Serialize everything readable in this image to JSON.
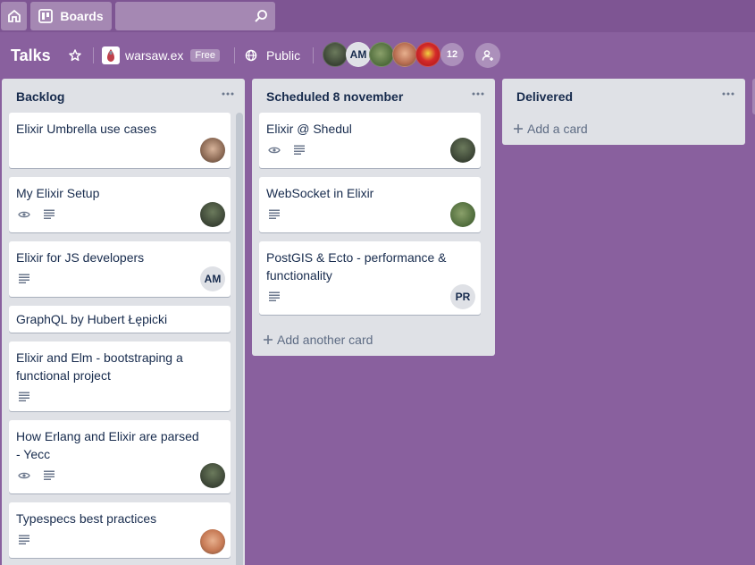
{
  "topbar": {
    "boards_label": "Boards",
    "search_value": ""
  },
  "board": {
    "title": "Talks",
    "team_name": "warsaw.ex",
    "team_badge": "Free",
    "visibility": "Public",
    "member_initials": "AM",
    "member_count": "12"
  },
  "lists": [
    {
      "title": "Backlog",
      "cards": [
        {
          "title": "Elixir Umbrella use cases",
          "watch": false,
          "description": false,
          "avatar": "photo"
        },
        {
          "title": "My Elixir Setup",
          "watch": true,
          "description": true,
          "avatar": "photo"
        },
        {
          "title": "Elixir for JS developers",
          "watch": false,
          "description": true,
          "avatar": "AM"
        },
        {
          "title": "GraphQL by Hubert Łępicki",
          "watch": false,
          "description": false,
          "avatar": ""
        },
        {
          "title": "Elixir and Elm - bootstraping a functional project",
          "watch": false,
          "description": true,
          "avatar": ""
        },
        {
          "title": "How Erlang and Elixir are parsed - Yecc",
          "watch": true,
          "description": true,
          "avatar": "photo"
        },
        {
          "title": "Typespecs best practices",
          "watch": false,
          "description": true,
          "avatar": "photo"
        }
      ]
    },
    {
      "title": "Scheduled 8 november",
      "cards": [
        {
          "title": "Elixir @ Shedul",
          "watch": true,
          "description": true,
          "avatar": "photo"
        },
        {
          "title": "WebSocket in Elixir",
          "watch": false,
          "description": true,
          "avatar": "photo"
        },
        {
          "title": "PostGIS & Ecto - performance & functionality",
          "watch": false,
          "description": true,
          "avatar": "PR"
        }
      ],
      "add_label": "Add another card"
    },
    {
      "title": "Delivered",
      "cards": [],
      "add_label": "Add a card"
    }
  ],
  "colors": {
    "board_bg": "#89609e",
    "list_bg": "#dfe1e6",
    "card_bg": "#ffffff"
  }
}
